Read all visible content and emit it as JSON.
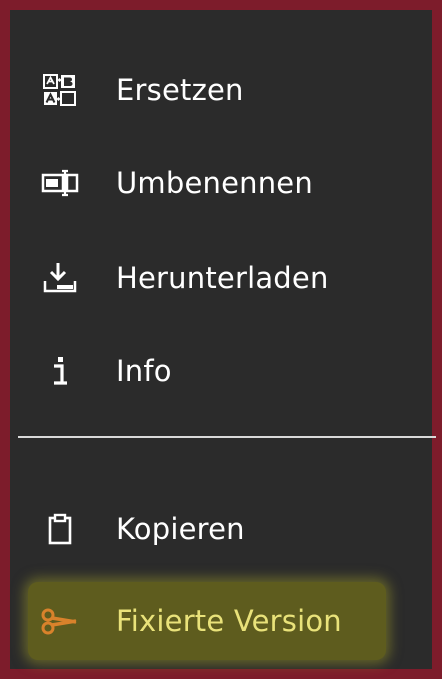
{
  "menu": {
    "items": [
      {
        "label": "Ersetzen",
        "icon": "replace-icon"
      },
      {
        "label": "Umbenennen",
        "icon": "rename-icon"
      },
      {
        "label": "Herunterladen",
        "icon": "download-icon"
      },
      {
        "label": "Info",
        "icon": "info-icon"
      }
    ],
    "secondary_items": [
      {
        "label": "Kopieren",
        "icon": "clipboard-icon"
      },
      {
        "label": "Fixierte Version",
        "icon": "scissors-icon",
        "highlighted": true
      }
    ]
  },
  "colors": {
    "background": "#2b2b2b",
    "border": "#7d1c2b",
    "text": "#ffffff",
    "highlight_bg": "#5e5c1e",
    "highlight_text": "#e9e27a",
    "scissors_icon": "#d9822b"
  }
}
